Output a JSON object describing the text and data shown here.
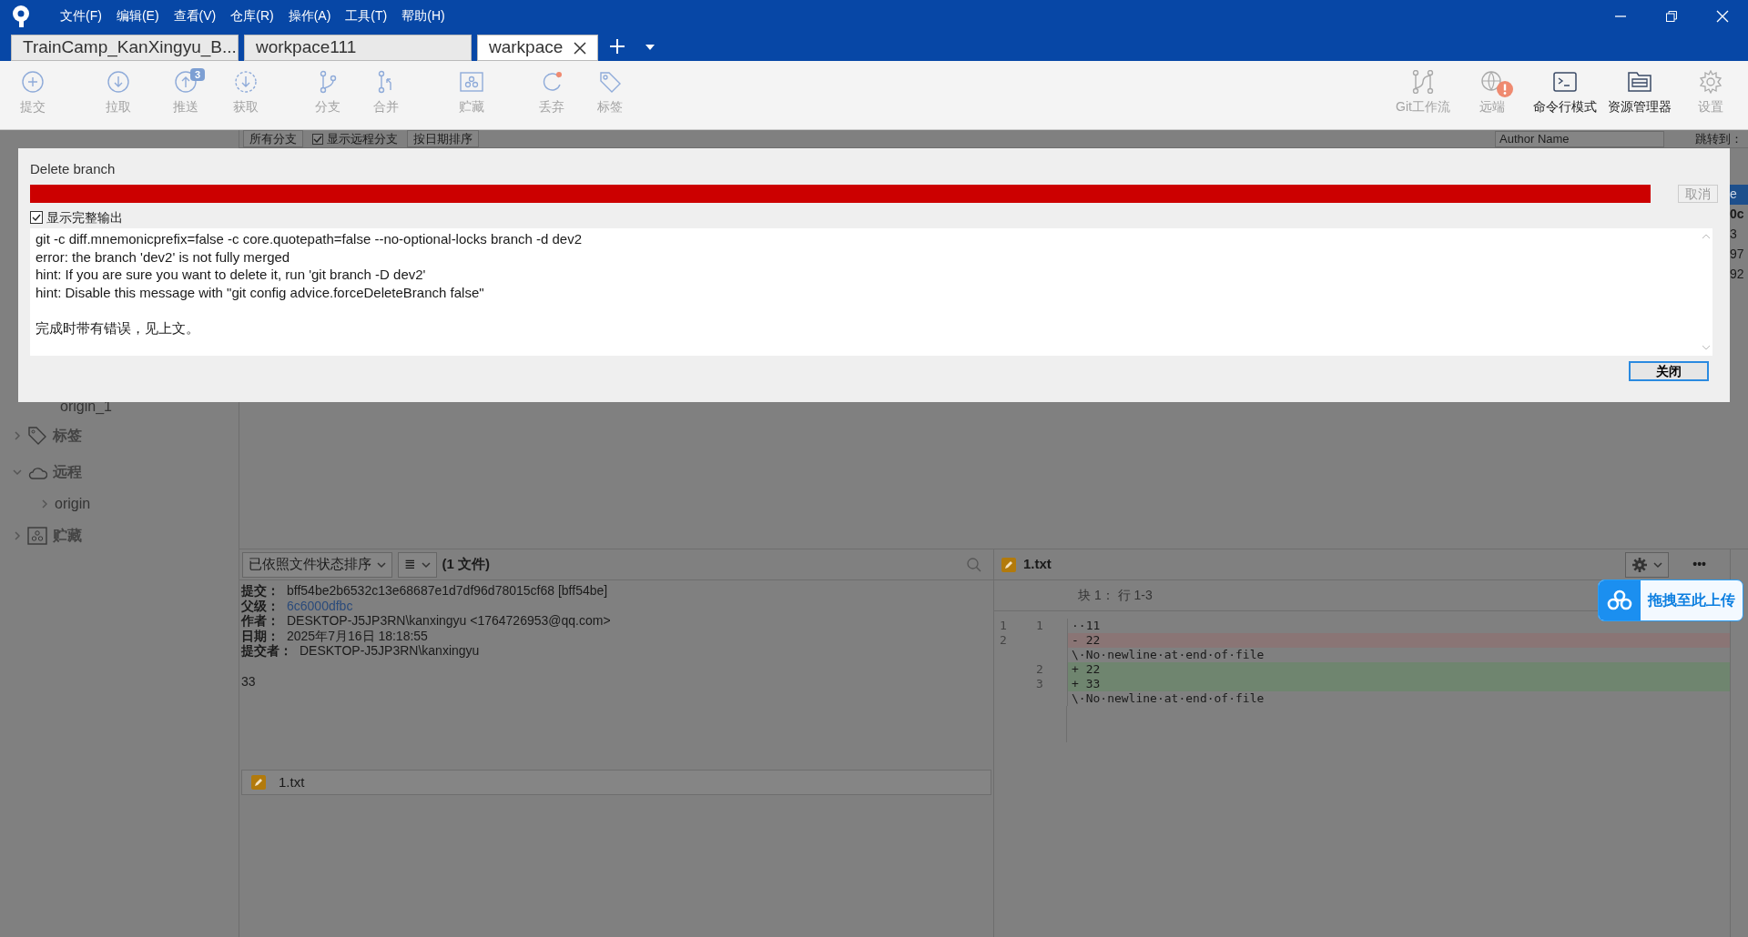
{
  "window": {
    "menu": [
      "文件(F)",
      "编辑(E)",
      "查看(V)",
      "仓库(R)",
      "操作(A)",
      "工具(T)",
      "帮助(H)"
    ],
    "tabs": [
      {
        "label": "TrainCamp_KanXingyu_B...",
        "selected": false
      },
      {
        "label": "workpace111",
        "selected": false
      },
      {
        "label": "warkpace",
        "selected": true
      }
    ]
  },
  "toolbar": {
    "left": [
      {
        "label": "提交",
        "disabled": true
      },
      {
        "label": "拉取",
        "disabled": true
      },
      {
        "label": "推送",
        "disabled": true,
        "badge": "3"
      },
      {
        "label": "获取",
        "disabled": true
      },
      {
        "label": "分支",
        "disabled": true
      },
      {
        "label": "合并",
        "disabled": true
      },
      {
        "label": "贮藏",
        "disabled": true
      },
      {
        "label": "丢弃",
        "disabled": true
      },
      {
        "label": "标签",
        "disabled": true
      }
    ],
    "right": [
      {
        "label": "Git工作流",
        "disabled": true
      },
      {
        "label": "远端",
        "disabled": true,
        "warning": true
      },
      {
        "label": "命令行模式",
        "disabled": false
      },
      {
        "label": "资源管理器",
        "disabled": false
      },
      {
        "label": "设置",
        "disabled": true
      }
    ]
  },
  "filter_bar": {
    "branches": "所有分支",
    "show_remote": {
      "label": "显示远程分支",
      "checked": true
    },
    "sort": "按日期排序",
    "author_search": {
      "placeholder": "Author Name"
    },
    "jump_to": "跳转到："
  },
  "commit_fragments": [
    {
      "text": "e",
      "selected": true
    },
    {
      "text": "0c",
      "selected": false
    },
    {
      "text": "3",
      "selected": false
    },
    {
      "text": "97",
      "selected": false
    },
    {
      "text": "92",
      "selected": false
    }
  ],
  "sidebar": {
    "items": [
      {
        "label": "origin_1",
        "kind": "branch"
      },
      {
        "label": "标签",
        "kind": "group",
        "expanded": false
      },
      {
        "label": "远程",
        "kind": "group",
        "expanded": true,
        "children": [
          {
            "label": "origin",
            "kind": "remote",
            "expanded": false
          }
        ]
      },
      {
        "label": "贮藏",
        "kind": "group",
        "expanded": false
      }
    ]
  },
  "files_panel": {
    "sort": "已依照文件状态排序",
    "view_menu": "≣",
    "count": "(1 文件)",
    "details": [
      {
        "label": "提交：",
        "value": "bff54be2b6532c13e68687e1d7df96d78015cf68 [bff54be]",
        "link": false
      },
      {
        "label": "父级：",
        "value": "6c6000dfbc",
        "link": true
      },
      {
        "label": "作者：",
        "value": "DESKTOP-J5JP3RN\\kanxingyu <1764726953@qq.com>",
        "link": false
      },
      {
        "label": "日期：",
        "value": "2025年7月16日 18:18:55",
        "link": false
      },
      {
        "label": "提交者：",
        "value": "DESKTOP-J5JP3RN\\kanxingyu",
        "link": false
      }
    ],
    "message": "33",
    "files": [
      {
        "name": "1.txt"
      }
    ]
  },
  "diff_panel": {
    "file": "1.txt",
    "more": "•••",
    "hunk": "块 1： 行 1-3",
    "lines": [
      {
        "kind": "context",
        "old": "1",
        "new": "1",
        "text": "··11"
      },
      {
        "kind": "removed",
        "old": "2",
        "text": "- 22"
      },
      {
        "kind": "note",
        "text": "\\·No·newline·at·end·of·file"
      },
      {
        "kind": "added",
        "new": "2",
        "text": "+ 22"
      },
      {
        "kind": "added",
        "new": "3",
        "text": "+ 33"
      },
      {
        "kind": "note",
        "text": "\\·No·newline·at·end·of·file"
      }
    ]
  },
  "upload_widget": {
    "label": "拖拽至此上传"
  },
  "dialog": {
    "title": "Delete branch",
    "progress": {
      "level": 1,
      "failed": true
    },
    "cancel": {
      "label": "取消",
      "disabled": true
    },
    "show_output": {
      "label": "显示完整输出",
      "checked": true
    },
    "output": [
      "git -c diff.mnemonicprefix=false -c core.quotepath=false --no-optional-locks branch -d dev2",
      "error: the branch 'dev2' is not fully merged",
      "hint: If you are sure you want to delete it, run 'git branch -D dev2'",
      "hint: Disable this message with \"git config advice.forceDeleteBranch false\""
    ],
    "summary": "完成时带有错误，见上文。",
    "close": {
      "label": "关闭"
    }
  }
}
